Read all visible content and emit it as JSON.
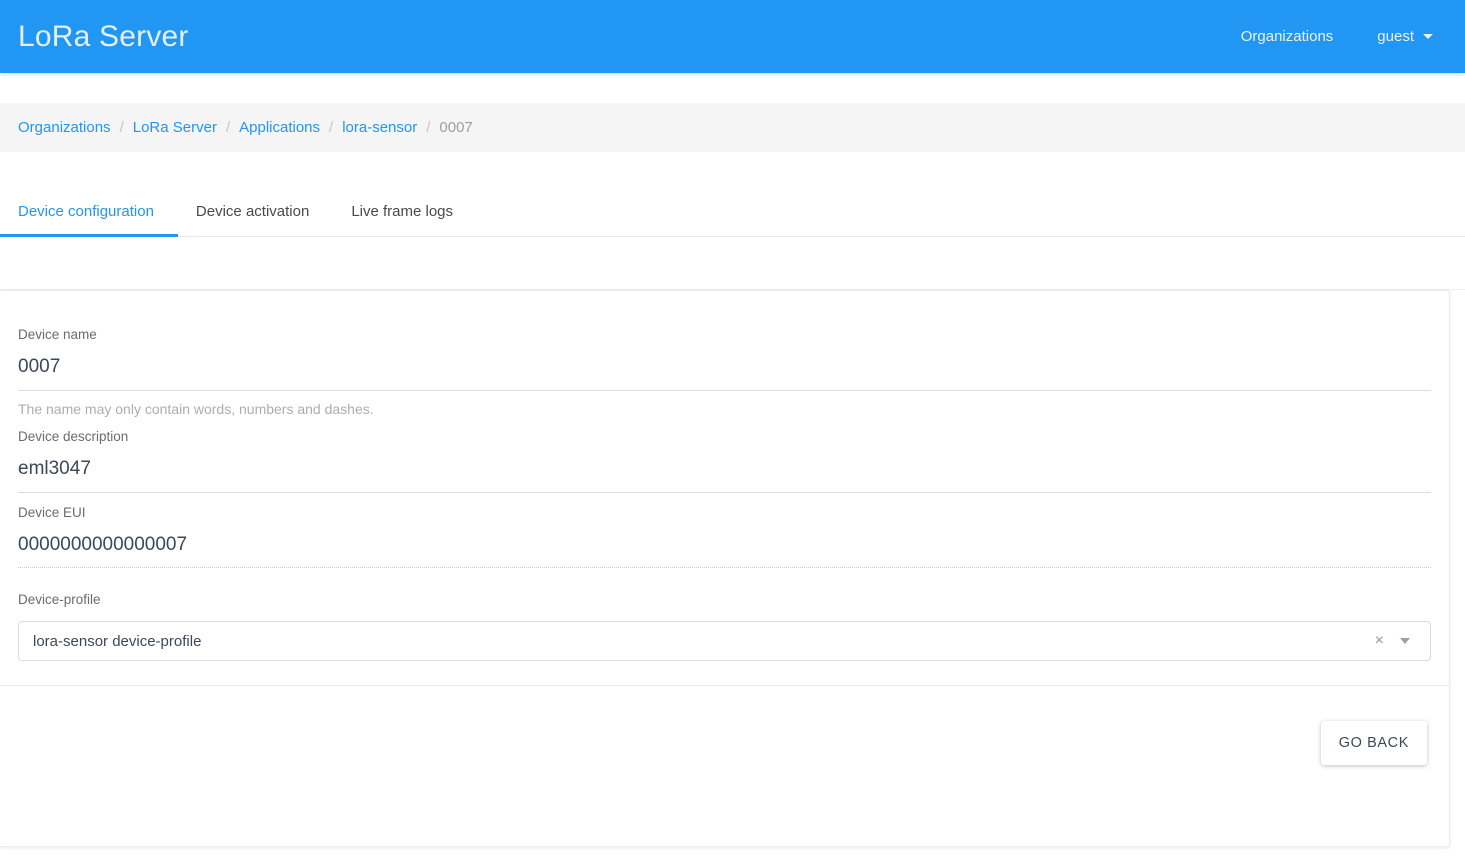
{
  "header": {
    "brand": "LoRa Server",
    "organizations_label": "Organizations",
    "user_label": "guest",
    "caret_icon": "chevron-down-icon",
    "background_color": "#2196f3"
  },
  "breadcrumb": {
    "separator": "/",
    "items": [
      {
        "label": "Organizations",
        "current": false
      },
      {
        "label": "LoRa Server",
        "current": false
      },
      {
        "label": "Applications",
        "current": false
      },
      {
        "label": "lora-sensor",
        "current": false
      },
      {
        "label": "0007",
        "current": true
      }
    ]
  },
  "tabs": [
    {
      "label": "Device configuration",
      "active": true
    },
    {
      "label": "Device activation",
      "active": false
    },
    {
      "label": "Live frame logs",
      "active": false
    }
  ],
  "form": {
    "device_name": {
      "label": "Device name",
      "value": "0007",
      "hint": "The name may only contain words, numbers and dashes."
    },
    "device_description": {
      "label": "Device description",
      "value": "eml3047"
    },
    "device_eui": {
      "label": "Device EUI",
      "value": "0000000000000007"
    },
    "device_profile": {
      "label": "Device-profile",
      "value": "lora-sensor device-profile",
      "clear_icon": "×",
      "caret_icon": "chevron-down-icon"
    }
  },
  "actions": {
    "go_back_label": "GO BACK"
  },
  "colors": {
    "accent": "#2196f3",
    "breadcrumb_bg": "#f5f5f5",
    "text_dark": "#3c4858",
    "text_muted": "#9e9e9e"
  }
}
